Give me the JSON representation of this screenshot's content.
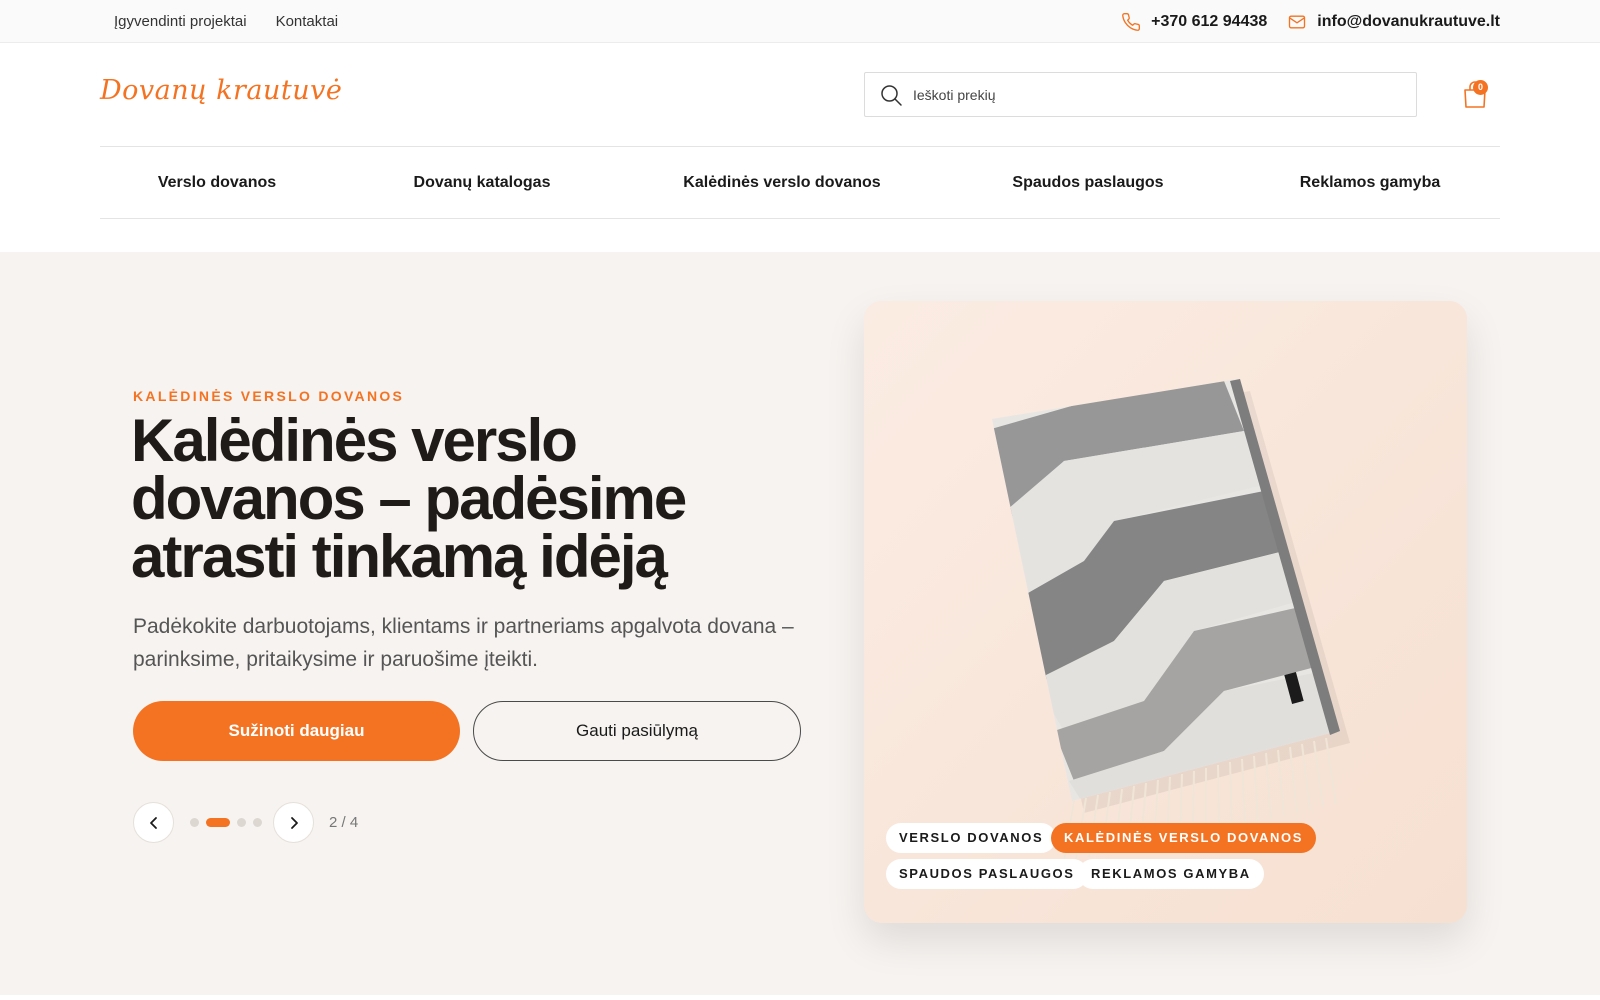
{
  "topbar": {
    "links": [
      "Įgyvendinti projektai",
      "Kontaktai"
    ],
    "phone": "+370 612 94438",
    "email": "info@dovanukrautuve.lt"
  },
  "header": {
    "logo_text": "Dovanų krautuvė",
    "search_placeholder": "Ieškoti prekių",
    "cart_count": "0"
  },
  "nav": {
    "items": [
      "Verslo dovanos",
      "Dovanų katalogas",
      "Kalėdinės verslo dovanos",
      "Spaudos paslaugos",
      "Reklamos gamyba"
    ]
  },
  "hero": {
    "eyebrow": "KALĖDINĖS VERSLO DOVANOS",
    "title_lines": [
      "Kalėdinės verslo",
      "dovanos – padėsime",
      "atrasti tinkamą idėją"
    ],
    "subtitle": "Padėkokite darbuotojams, klientams ir partneriams apgalvota dovana – parinksime, pritaikysime ir paruošime įteikti.",
    "primary_cta": "Sužinoti daugiau",
    "secondary_cta": "Gauti pasiūlymą",
    "slide_current": 2,
    "slide_total": 4,
    "counter_text": "2 / 4"
  },
  "card": {
    "chips": [
      {
        "label": "VERSLO DOVANOS",
        "active": false
      },
      {
        "label": "KALĖDINĖS VERSLO DOVANOS",
        "active": true
      },
      {
        "label": "SPAUDOS PASLAUGOS",
        "active": false
      },
      {
        "label": "REKLAMOS GAMYBA",
        "active": false
      }
    ]
  },
  "colors": {
    "accent": "#f47322",
    "hero_bg": "#f7f3f0",
    "card_bg": "#f8e6da",
    "text_dark": "#1e1b19"
  }
}
